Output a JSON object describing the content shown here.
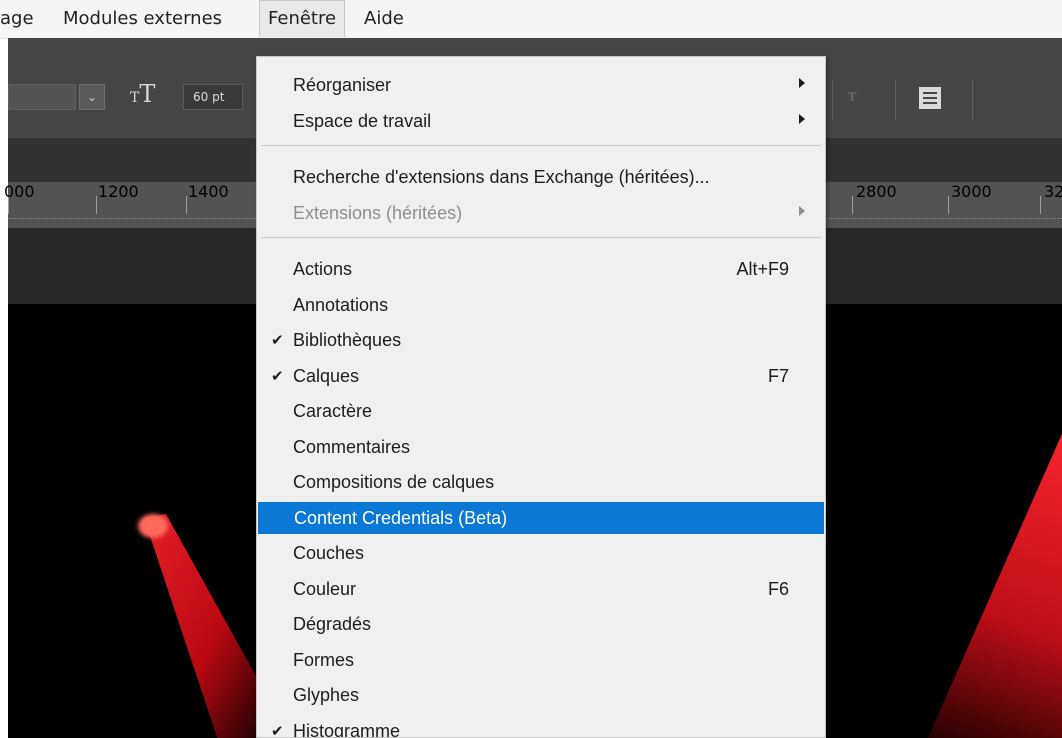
{
  "menubar": {
    "items": [
      "age",
      "Modules externes",
      "Fenêtre",
      "Aide"
    ]
  },
  "options_bar": {
    "font_size": "60 pt"
  },
  "ruler": {
    "ticks": [
      "000",
      "1200",
      "1400",
      "2800",
      "3000",
      "32"
    ]
  },
  "window_menu": {
    "groups": [
      [
        {
          "label": "Réorganiser",
          "submenu": true
        },
        {
          "label": "Espace de travail",
          "submenu": true
        }
      ],
      [
        {
          "label": "Recherche d'extensions dans Exchange (héritées)..."
        },
        {
          "label": "Extensions (héritées)",
          "submenu": true,
          "disabled": true
        }
      ],
      [
        {
          "label": "Actions",
          "shortcut": "Alt+F9"
        },
        {
          "label": "Annotations"
        },
        {
          "label": "Bibliothèques",
          "checked": true
        },
        {
          "label": "Calques",
          "checked": true,
          "shortcut": "F7"
        },
        {
          "label": "Caractère"
        },
        {
          "label": "Commentaires"
        },
        {
          "label": "Compositions de calques"
        },
        {
          "label": "Content Credentials (Beta)",
          "highlighted": true
        },
        {
          "label": "Couches"
        },
        {
          "label": "Couleur",
          "shortcut": "F6"
        },
        {
          "label": "Dégradés"
        },
        {
          "label": "Formes"
        },
        {
          "label": "Glyphes"
        },
        {
          "label": "Histogramme",
          "checked": true
        }
      ]
    ]
  },
  "icons": {
    "text_size": "text-size-icon",
    "warp": "warp-text-icon",
    "panels": "character-panels-icon",
    "dropdown": "chevron-down-icon",
    "check": "checkmark-icon",
    "submenu": "submenu-arrow-icon"
  },
  "colors": {
    "highlight": "#0a78d4",
    "menu_bg": "#f0f0f0",
    "disabled_text": "#8f8f8f"
  }
}
